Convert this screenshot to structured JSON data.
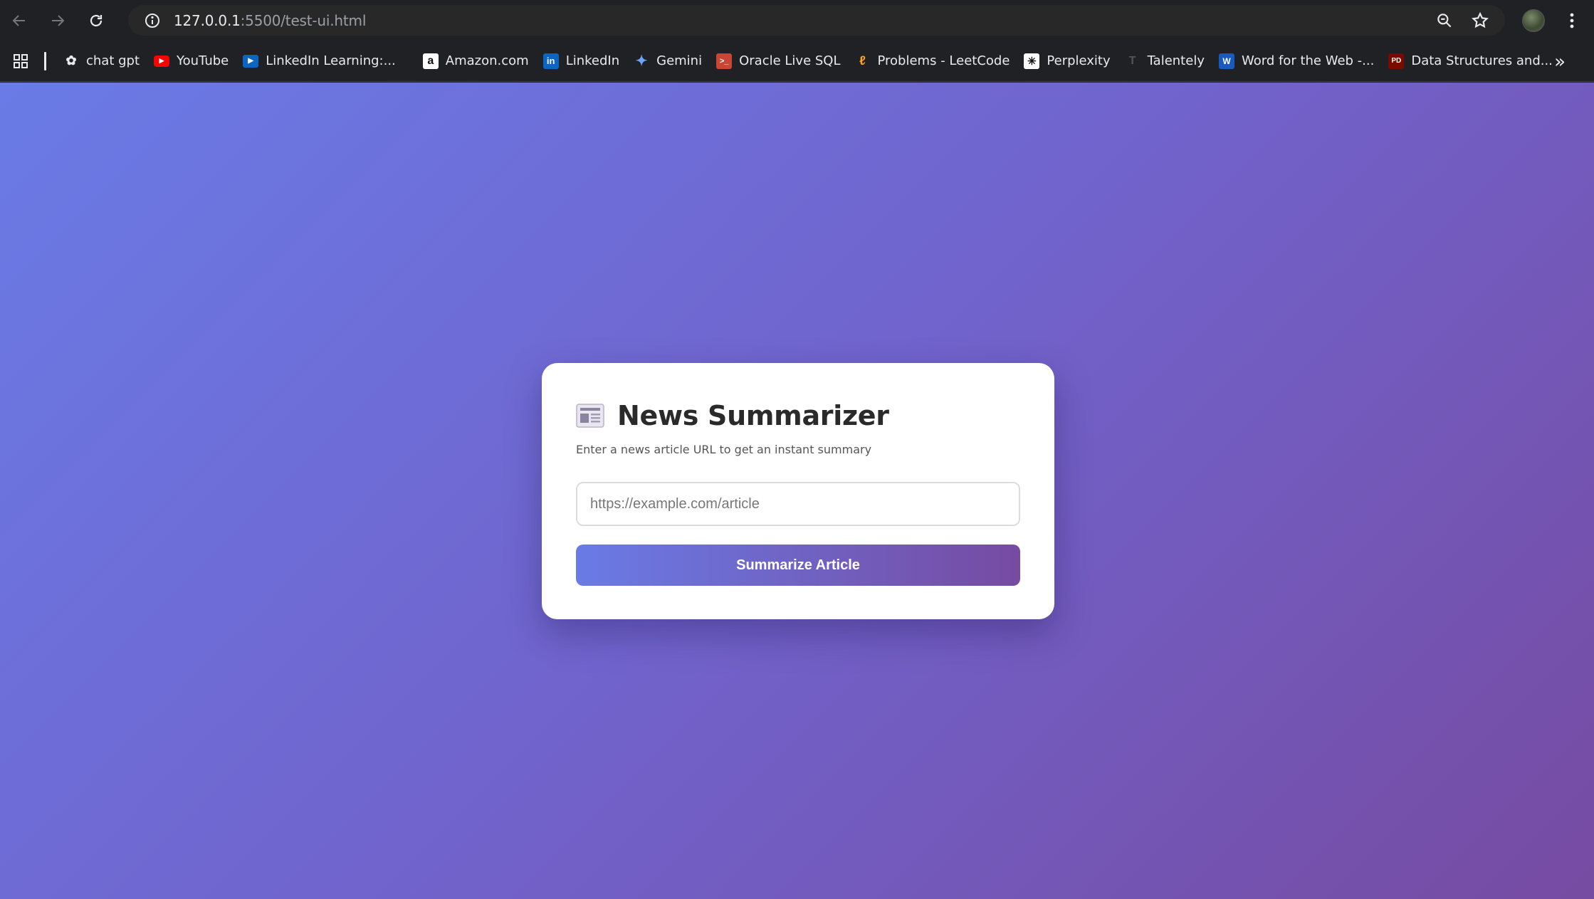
{
  "browser": {
    "url_host": "127.0.0.1",
    "url_rest": ":5500/test-ui.html",
    "icons": {
      "back": "arrow-left-icon",
      "forward": "arrow-right-icon",
      "reload": "reload-icon",
      "site_info": "info-icon",
      "zoom": "zoom-icon",
      "bookmark": "star-icon",
      "menu": "kebab-menu-icon",
      "apps": "apps-grid-icon",
      "more_bookmarks": "chevron-double-right-icon"
    }
  },
  "bookmarks": [
    {
      "label": "chat gpt",
      "icon": "chatgpt-icon",
      "color": "#202124"
    },
    {
      "label": "YouTube",
      "icon": "youtube-icon",
      "color": "#ff0000"
    },
    {
      "label": "LinkedIn Learning:...",
      "icon": "linkedin-learning-icon",
      "color": "#0a66c2"
    },
    {
      "label": "Amazon.com",
      "icon": "amazon-icon",
      "color": "#ffffff"
    },
    {
      "label": "LinkedIn",
      "icon": "linkedin-icon",
      "color": "#0a66c2"
    },
    {
      "label": "Gemini",
      "icon": "gemini-icon",
      "color": "#4f8cf7"
    },
    {
      "label": "Oracle Live SQL",
      "icon": "oracle-icon",
      "color": "#c74634"
    },
    {
      "label": "Problems - LeetCode",
      "icon": "leetcode-icon",
      "color": "#ffa116"
    },
    {
      "label": "Perplexity",
      "icon": "perplexity-icon",
      "color": "#ffffff"
    },
    {
      "label": "Talentely",
      "icon": "talentely-icon",
      "color": "#333333"
    },
    {
      "label": "Word for the Web -...",
      "icon": "word-icon",
      "color": "#185abd"
    },
    {
      "label": "Data Structures and...",
      "icon": "pdf-icon",
      "color": "#b30b00"
    }
  ],
  "app": {
    "title": "News Summarizer",
    "title_icon": "newspaper-icon",
    "subtitle": "Enter a news article URL to get an instant summary",
    "url_placeholder": "https://example.com/article",
    "url_value": "",
    "submit_label": "Summarize Article",
    "colors": {
      "gradient_start": "#6a7be6",
      "gradient_end": "#764ba2"
    }
  }
}
